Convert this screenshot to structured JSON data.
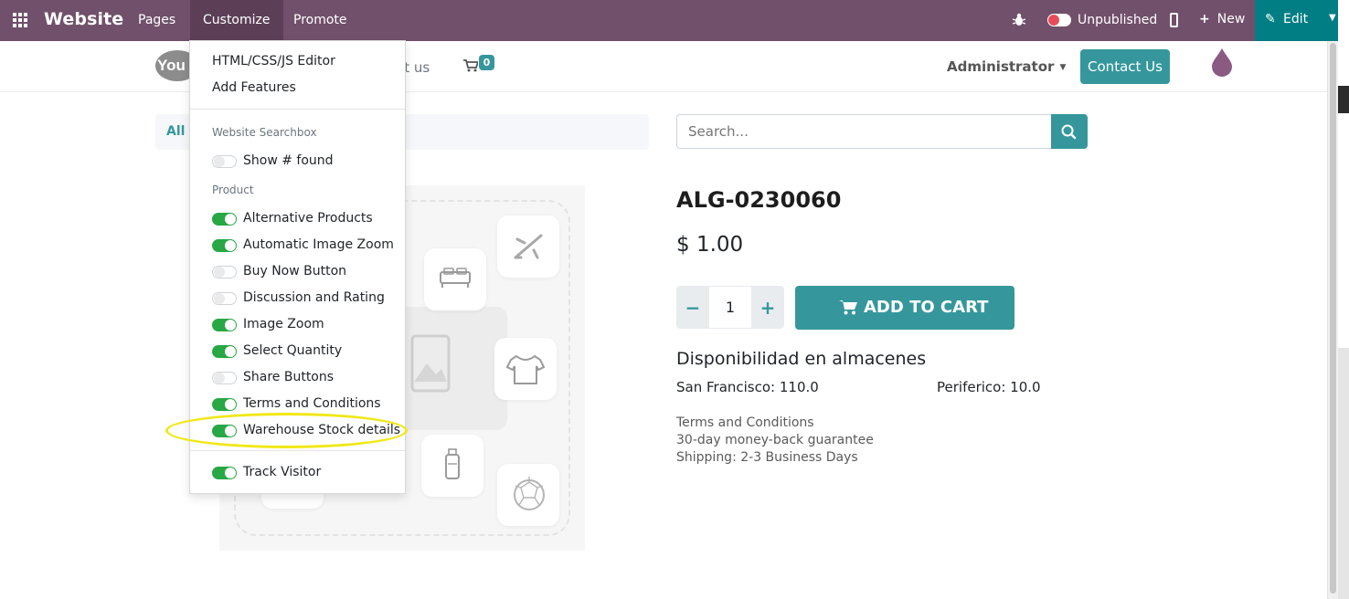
{
  "topbar": {
    "brand": "Website",
    "menus": [
      "Pages",
      "Customize",
      "Promote"
    ],
    "publish_status": "Unpublished",
    "new_label": "New",
    "edit_label": "Edit"
  },
  "header": {
    "logo_text": "You",
    "nav_partial": "ct us",
    "cart_count": "0",
    "user_menu": "Administrator",
    "contact_button": "Contact Us"
  },
  "breadcrumb": {
    "text": "All P"
  },
  "search": {
    "placeholder": "Search..."
  },
  "product": {
    "name": "ALG-0230060",
    "price": "$ 1.00",
    "quantity": "1",
    "add_to_cart": "ADD TO CART",
    "stock_title": "Disponibilidad en almacenes",
    "stock": [
      {
        "label": "San Francisco: 110.0"
      },
      {
        "label": "Periferico: 10.0"
      }
    ],
    "terms": [
      "Terms and Conditions",
      "30-day money-back guarantee",
      "Shipping: 2-3 Business Days"
    ]
  },
  "dropdown": {
    "editor": "HTML/CSS/JS Editor",
    "add_features": "Add Features",
    "searchbox_header": "Website Searchbox",
    "show_found": {
      "label": "Show # found",
      "on": false
    },
    "product_header": "Product",
    "product_options": [
      {
        "label": "Alternative Products",
        "on": true
      },
      {
        "label": "Automatic Image Zoom",
        "on": true
      },
      {
        "label": "Buy Now Button",
        "on": false
      },
      {
        "label": "Discussion and Rating",
        "on": false
      },
      {
        "label": "Image Zoom",
        "on": true
      },
      {
        "label": "Select Quantity",
        "on": true
      },
      {
        "label": "Share Buttons",
        "on": false
      },
      {
        "label": "Terms and Conditions",
        "on": true
      },
      {
        "label": "Warehouse Stock details",
        "on": true
      }
    ],
    "track_visitor": {
      "label": "Track Visitor",
      "on": true
    }
  },
  "colors": {
    "topbar": "#71506b",
    "accent": "#35979c",
    "edit": "#017e84",
    "toggle_on": "#28a745",
    "highlight": "#f0e817"
  },
  "icons": [
    "apps-grid-icon",
    "bug-icon",
    "mobile-icon",
    "plus-icon",
    "pencil-icon",
    "cart-icon",
    "search-icon",
    "drop-icon"
  ]
}
